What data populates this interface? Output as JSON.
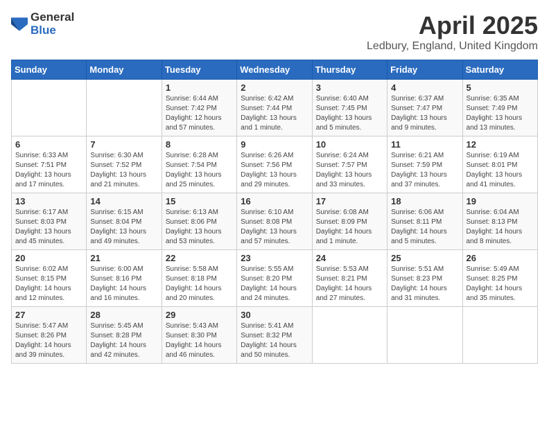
{
  "header": {
    "logo_general": "General",
    "logo_blue": "Blue",
    "title": "April 2025",
    "location": "Ledbury, England, United Kingdom"
  },
  "weekdays": [
    "Sunday",
    "Monday",
    "Tuesday",
    "Wednesday",
    "Thursday",
    "Friday",
    "Saturday"
  ],
  "weeks": [
    [
      {
        "day": "",
        "info": ""
      },
      {
        "day": "",
        "info": ""
      },
      {
        "day": "1",
        "info": "Sunrise: 6:44 AM\nSunset: 7:42 PM\nDaylight: 12 hours and 57 minutes."
      },
      {
        "day": "2",
        "info": "Sunrise: 6:42 AM\nSunset: 7:44 PM\nDaylight: 13 hours and 1 minute."
      },
      {
        "day": "3",
        "info": "Sunrise: 6:40 AM\nSunset: 7:45 PM\nDaylight: 13 hours and 5 minutes."
      },
      {
        "day": "4",
        "info": "Sunrise: 6:37 AM\nSunset: 7:47 PM\nDaylight: 13 hours and 9 minutes."
      },
      {
        "day": "5",
        "info": "Sunrise: 6:35 AM\nSunset: 7:49 PM\nDaylight: 13 hours and 13 minutes."
      }
    ],
    [
      {
        "day": "6",
        "info": "Sunrise: 6:33 AM\nSunset: 7:51 PM\nDaylight: 13 hours and 17 minutes."
      },
      {
        "day": "7",
        "info": "Sunrise: 6:30 AM\nSunset: 7:52 PM\nDaylight: 13 hours and 21 minutes."
      },
      {
        "day": "8",
        "info": "Sunrise: 6:28 AM\nSunset: 7:54 PM\nDaylight: 13 hours and 25 minutes."
      },
      {
        "day": "9",
        "info": "Sunrise: 6:26 AM\nSunset: 7:56 PM\nDaylight: 13 hours and 29 minutes."
      },
      {
        "day": "10",
        "info": "Sunrise: 6:24 AM\nSunset: 7:57 PM\nDaylight: 13 hours and 33 minutes."
      },
      {
        "day": "11",
        "info": "Sunrise: 6:21 AM\nSunset: 7:59 PM\nDaylight: 13 hours and 37 minutes."
      },
      {
        "day": "12",
        "info": "Sunrise: 6:19 AM\nSunset: 8:01 PM\nDaylight: 13 hours and 41 minutes."
      }
    ],
    [
      {
        "day": "13",
        "info": "Sunrise: 6:17 AM\nSunset: 8:03 PM\nDaylight: 13 hours and 45 minutes."
      },
      {
        "day": "14",
        "info": "Sunrise: 6:15 AM\nSunset: 8:04 PM\nDaylight: 13 hours and 49 minutes."
      },
      {
        "day": "15",
        "info": "Sunrise: 6:13 AM\nSunset: 8:06 PM\nDaylight: 13 hours and 53 minutes."
      },
      {
        "day": "16",
        "info": "Sunrise: 6:10 AM\nSunset: 8:08 PM\nDaylight: 13 hours and 57 minutes."
      },
      {
        "day": "17",
        "info": "Sunrise: 6:08 AM\nSunset: 8:09 PM\nDaylight: 14 hours and 1 minute."
      },
      {
        "day": "18",
        "info": "Sunrise: 6:06 AM\nSunset: 8:11 PM\nDaylight: 14 hours and 5 minutes."
      },
      {
        "day": "19",
        "info": "Sunrise: 6:04 AM\nSunset: 8:13 PM\nDaylight: 14 hours and 8 minutes."
      }
    ],
    [
      {
        "day": "20",
        "info": "Sunrise: 6:02 AM\nSunset: 8:15 PM\nDaylight: 14 hours and 12 minutes."
      },
      {
        "day": "21",
        "info": "Sunrise: 6:00 AM\nSunset: 8:16 PM\nDaylight: 14 hours and 16 minutes."
      },
      {
        "day": "22",
        "info": "Sunrise: 5:58 AM\nSunset: 8:18 PM\nDaylight: 14 hours and 20 minutes."
      },
      {
        "day": "23",
        "info": "Sunrise: 5:55 AM\nSunset: 8:20 PM\nDaylight: 14 hours and 24 minutes."
      },
      {
        "day": "24",
        "info": "Sunrise: 5:53 AM\nSunset: 8:21 PM\nDaylight: 14 hours and 27 minutes."
      },
      {
        "day": "25",
        "info": "Sunrise: 5:51 AM\nSunset: 8:23 PM\nDaylight: 14 hours and 31 minutes."
      },
      {
        "day": "26",
        "info": "Sunrise: 5:49 AM\nSunset: 8:25 PM\nDaylight: 14 hours and 35 minutes."
      }
    ],
    [
      {
        "day": "27",
        "info": "Sunrise: 5:47 AM\nSunset: 8:26 PM\nDaylight: 14 hours and 39 minutes."
      },
      {
        "day": "28",
        "info": "Sunrise: 5:45 AM\nSunset: 8:28 PM\nDaylight: 14 hours and 42 minutes."
      },
      {
        "day": "29",
        "info": "Sunrise: 5:43 AM\nSunset: 8:30 PM\nDaylight: 14 hours and 46 minutes."
      },
      {
        "day": "30",
        "info": "Sunrise: 5:41 AM\nSunset: 8:32 PM\nDaylight: 14 hours and 50 minutes."
      },
      {
        "day": "",
        "info": ""
      },
      {
        "day": "",
        "info": ""
      },
      {
        "day": "",
        "info": ""
      }
    ]
  ]
}
